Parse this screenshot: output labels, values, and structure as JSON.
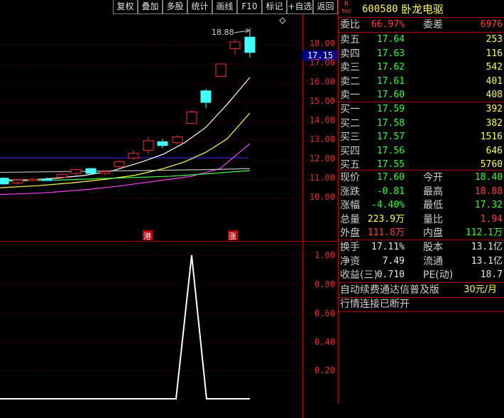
{
  "toolbar": [
    "复权",
    "叠加",
    "多股",
    "统计",
    "画线",
    "F10",
    "标记",
    "+自选",
    "返回"
  ],
  "chart": {
    "peak_label": "18.88",
    "current_price_tag": "17.15",
    "price_ticks": [
      "18.00",
      "17.00",
      "16.00",
      "15.00",
      "14.00",
      "13.00",
      "12.00",
      "11.00",
      "10.00"
    ],
    "markers": [
      "港",
      "涨"
    ],
    "diamond_icon": "diamond-icon",
    "sub_ticks": [
      "1.00",
      "0.80",
      "0.60",
      "0.40",
      "0.20"
    ],
    "colors": {
      "up": "#ff3030",
      "down": "#40ffff",
      "ma5": "#ffffff",
      "ma10": "#ffff40",
      "ma20": "#ff40ff",
      "ma60": "#40ff40"
    }
  },
  "quote": {
    "badge_top": "R",
    "badge_bottom": "500",
    "code": "600580",
    "name": "卧龙电驱",
    "weibi_label": "委比",
    "weibi_value": "66.97%",
    "weicha_label": "委差",
    "weicha_value": "6976",
    "asks": [
      {
        "label": "卖五",
        "price": "17.64",
        "vol": "253"
      },
      {
        "label": "卖四",
        "price": "17.63",
        "vol": "116"
      },
      {
        "label": "卖三",
        "price": "17.62",
        "vol": "542"
      },
      {
        "label": "卖二",
        "price": "17.61",
        "vol": "401"
      },
      {
        "label": "卖一",
        "price": "17.60",
        "vol": "408"
      }
    ],
    "bids": [
      {
        "label": "买一",
        "price": "17.59",
        "vol": "392"
      },
      {
        "label": "买二",
        "price": "17.58",
        "vol": "382"
      },
      {
        "label": "买三",
        "price": "17.57",
        "vol": "1516"
      },
      {
        "label": "买四",
        "price": "17.56",
        "vol": "646"
      },
      {
        "label": "买五",
        "price": "17.55",
        "vol": "5760"
      }
    ],
    "stats": [
      {
        "l1": "现价",
        "v1": "17.60",
        "c1": "green",
        "l2": "今开",
        "v2": "18.40",
        "c2": "green"
      },
      {
        "l1": "涨跌",
        "v1": "-0.81",
        "c1": "green",
        "l2": "最高",
        "v2": "18.88",
        "c2": "red"
      },
      {
        "l1": "涨幅",
        "v1": "-4.40%",
        "c1": "green",
        "l2": "最低",
        "v2": "17.32",
        "c2": "green"
      },
      {
        "l1": "总量",
        "v1": "223.9万",
        "c1": "yellow",
        "l2": "量比",
        "v2": "1.94",
        "c2": "red"
      },
      {
        "l1": "外盘",
        "v1": "111.8万",
        "c1": "red",
        "l2": "内盘",
        "v2": "112.1万",
        "c2": "green"
      }
    ],
    "fund": [
      {
        "l1": "换手",
        "v1": "17.11%",
        "l2": "股本",
        "v2": "13.1亿"
      },
      {
        "l1": "净资",
        "v1": "7.49",
        "l2": "流通",
        "v2": "13.1亿"
      },
      {
        "l1": "收益(三)",
        "v1": "0.710",
        "l2": "PE(动)",
        "v2": "18.7"
      }
    ],
    "promo_text": "自动续费通达信普及版",
    "promo_price": "30元/月",
    "status": "行情连接已断开"
  }
}
